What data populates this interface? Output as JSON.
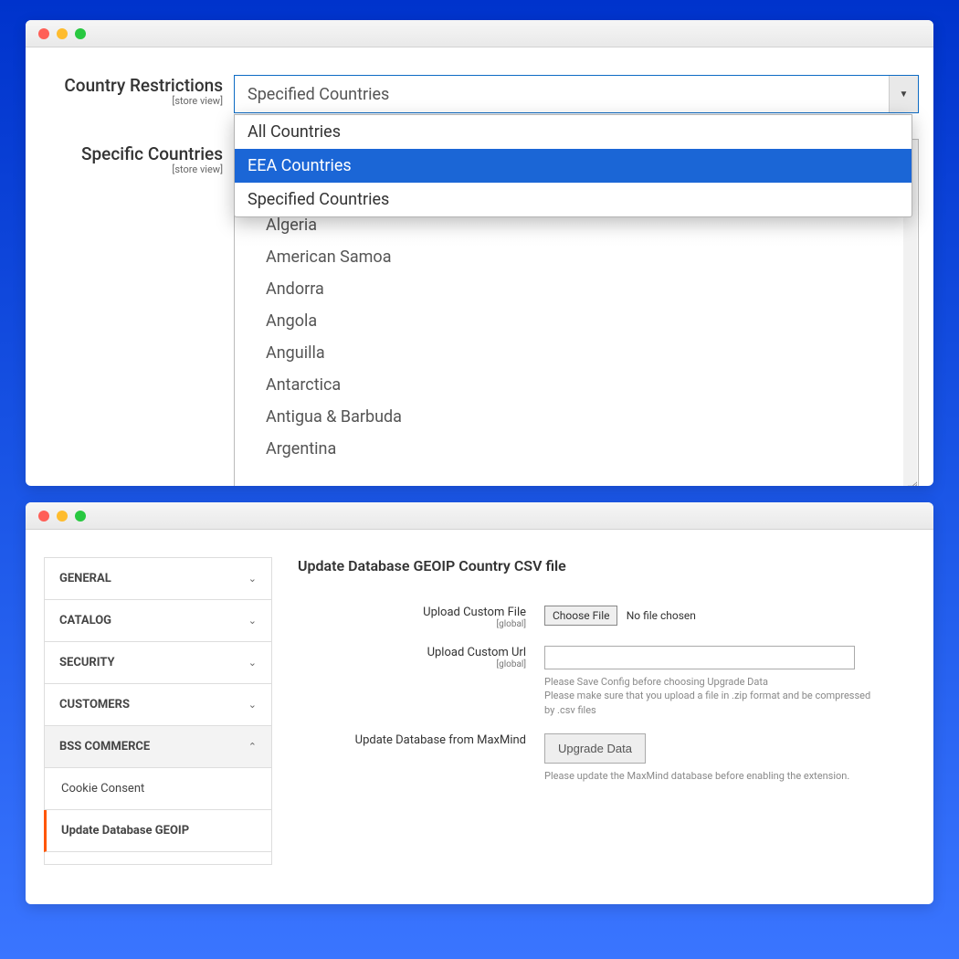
{
  "w1": {
    "country_restrictions_label": "Country Restrictions",
    "specific_countries_label": "Specific Countries",
    "scope_text": "[store view]",
    "select_value": "Specified Countries",
    "options": [
      "All Countries",
      "EEA Countries",
      "Specified Countries"
    ],
    "countries_visible": [
      "Algeria",
      "American Samoa",
      "Andorra",
      "Angola",
      "Anguilla",
      "Antarctica",
      "Antigua & Barbuda",
      "Argentina"
    ]
  },
  "w2": {
    "nav_groups": [
      "GENERAL",
      "CATALOG",
      "SECURITY",
      "CUSTOMERS",
      "BSS COMMERCE"
    ],
    "nav_sub": [
      "Cookie Consent",
      "Update Database GEOIP"
    ],
    "heading": "Update Database GEOIP Country CSV file",
    "upload_file_label": "Upload Custom File",
    "upload_url_label": "Upload Custom Url",
    "update_db_label": "Update Database from MaxMind",
    "scope_global": "[global]",
    "choose_file_btn": "Choose File",
    "no_file_text": "No file chosen",
    "url_hint1": "Please Save Config before choosing Upgrade Data",
    "url_hint2": "Please make sure that you upload a file in .zip format and be compressed by .csv files",
    "upgrade_btn": "Upgrade Data",
    "upgrade_hint": "Please update the MaxMind database before enabling the extension."
  }
}
